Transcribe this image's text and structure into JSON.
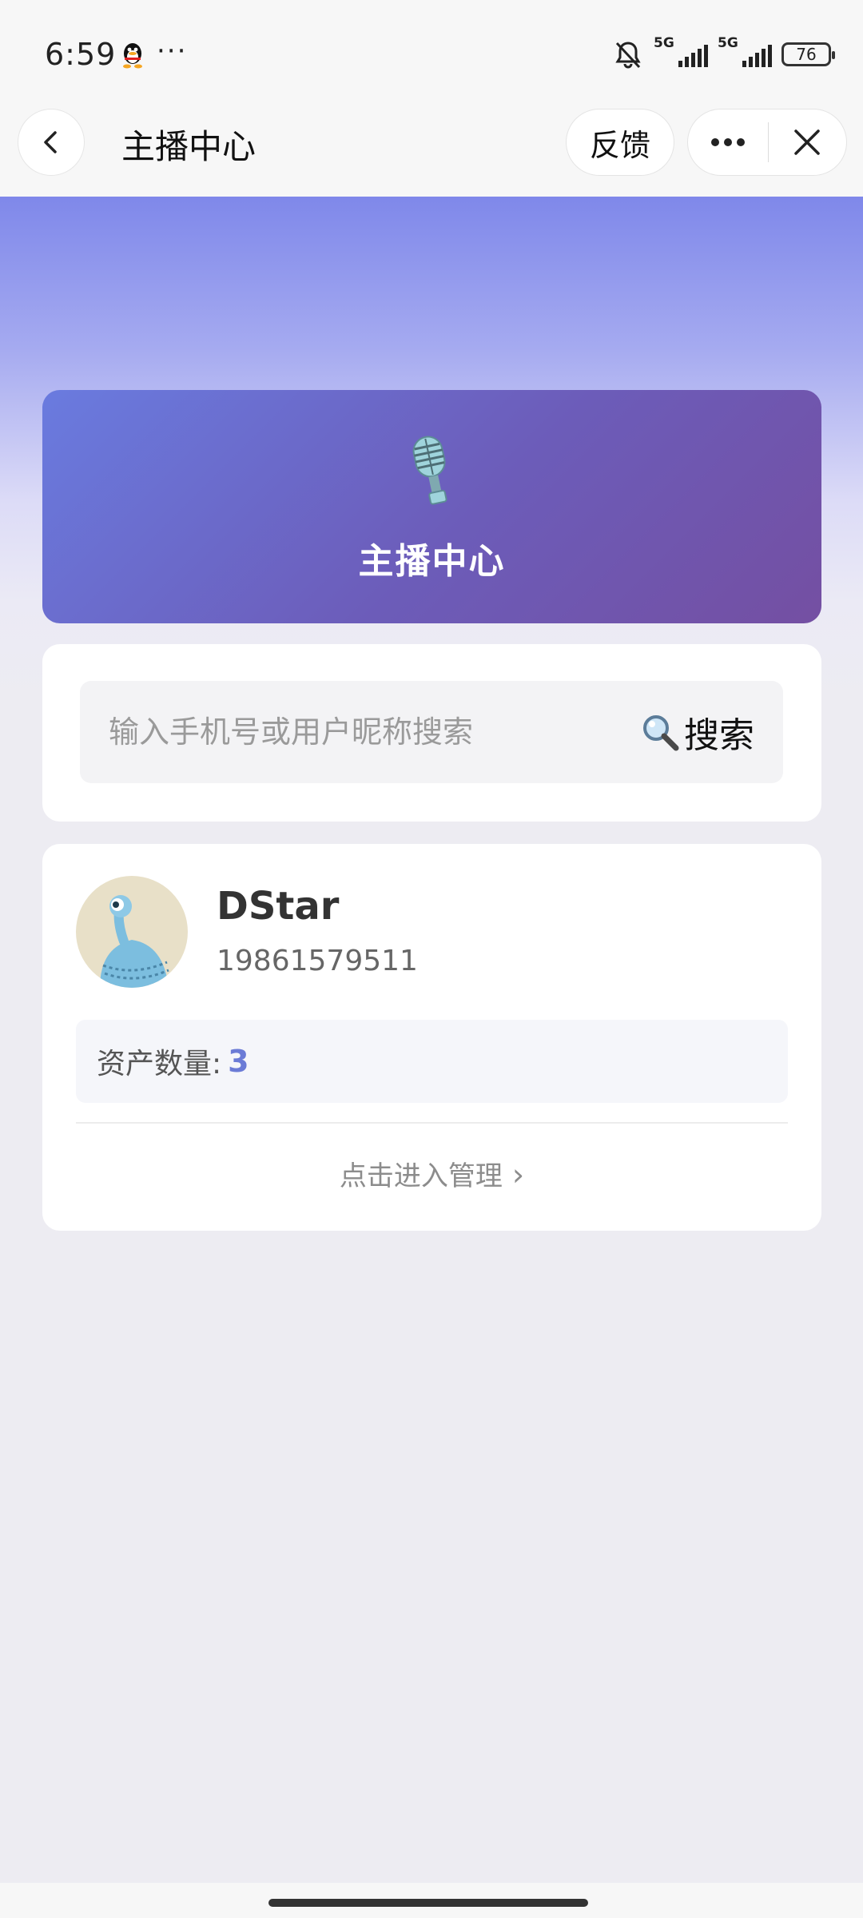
{
  "status_bar": {
    "time": "6:59",
    "notification_icons": [
      "qq-penguin-icon",
      "more-dots-icon"
    ],
    "dots": "···",
    "network1": "5G",
    "network2": "5G",
    "battery": "76"
  },
  "nav": {
    "title": "主播中心",
    "feedback_label": "反馈"
  },
  "hero": {
    "icon": "microphone-icon",
    "title": "主播中心"
  },
  "search": {
    "placeholder": "输入手机号或用户昵称搜索",
    "value": "",
    "button_icon": "magnifier-icon",
    "button_label": "搜索"
  },
  "user": {
    "name": "DStar",
    "phone": "19861579511",
    "asset_label": "资产数量:",
    "asset_count": "3",
    "manage_label": "点击进入管理",
    "manage_chevron": "›"
  },
  "colors": {
    "accent": "#6b7bd6",
    "hero_start": "#6a7bdf",
    "hero_end": "#744fa2",
    "page_bg": "#edecf2"
  }
}
